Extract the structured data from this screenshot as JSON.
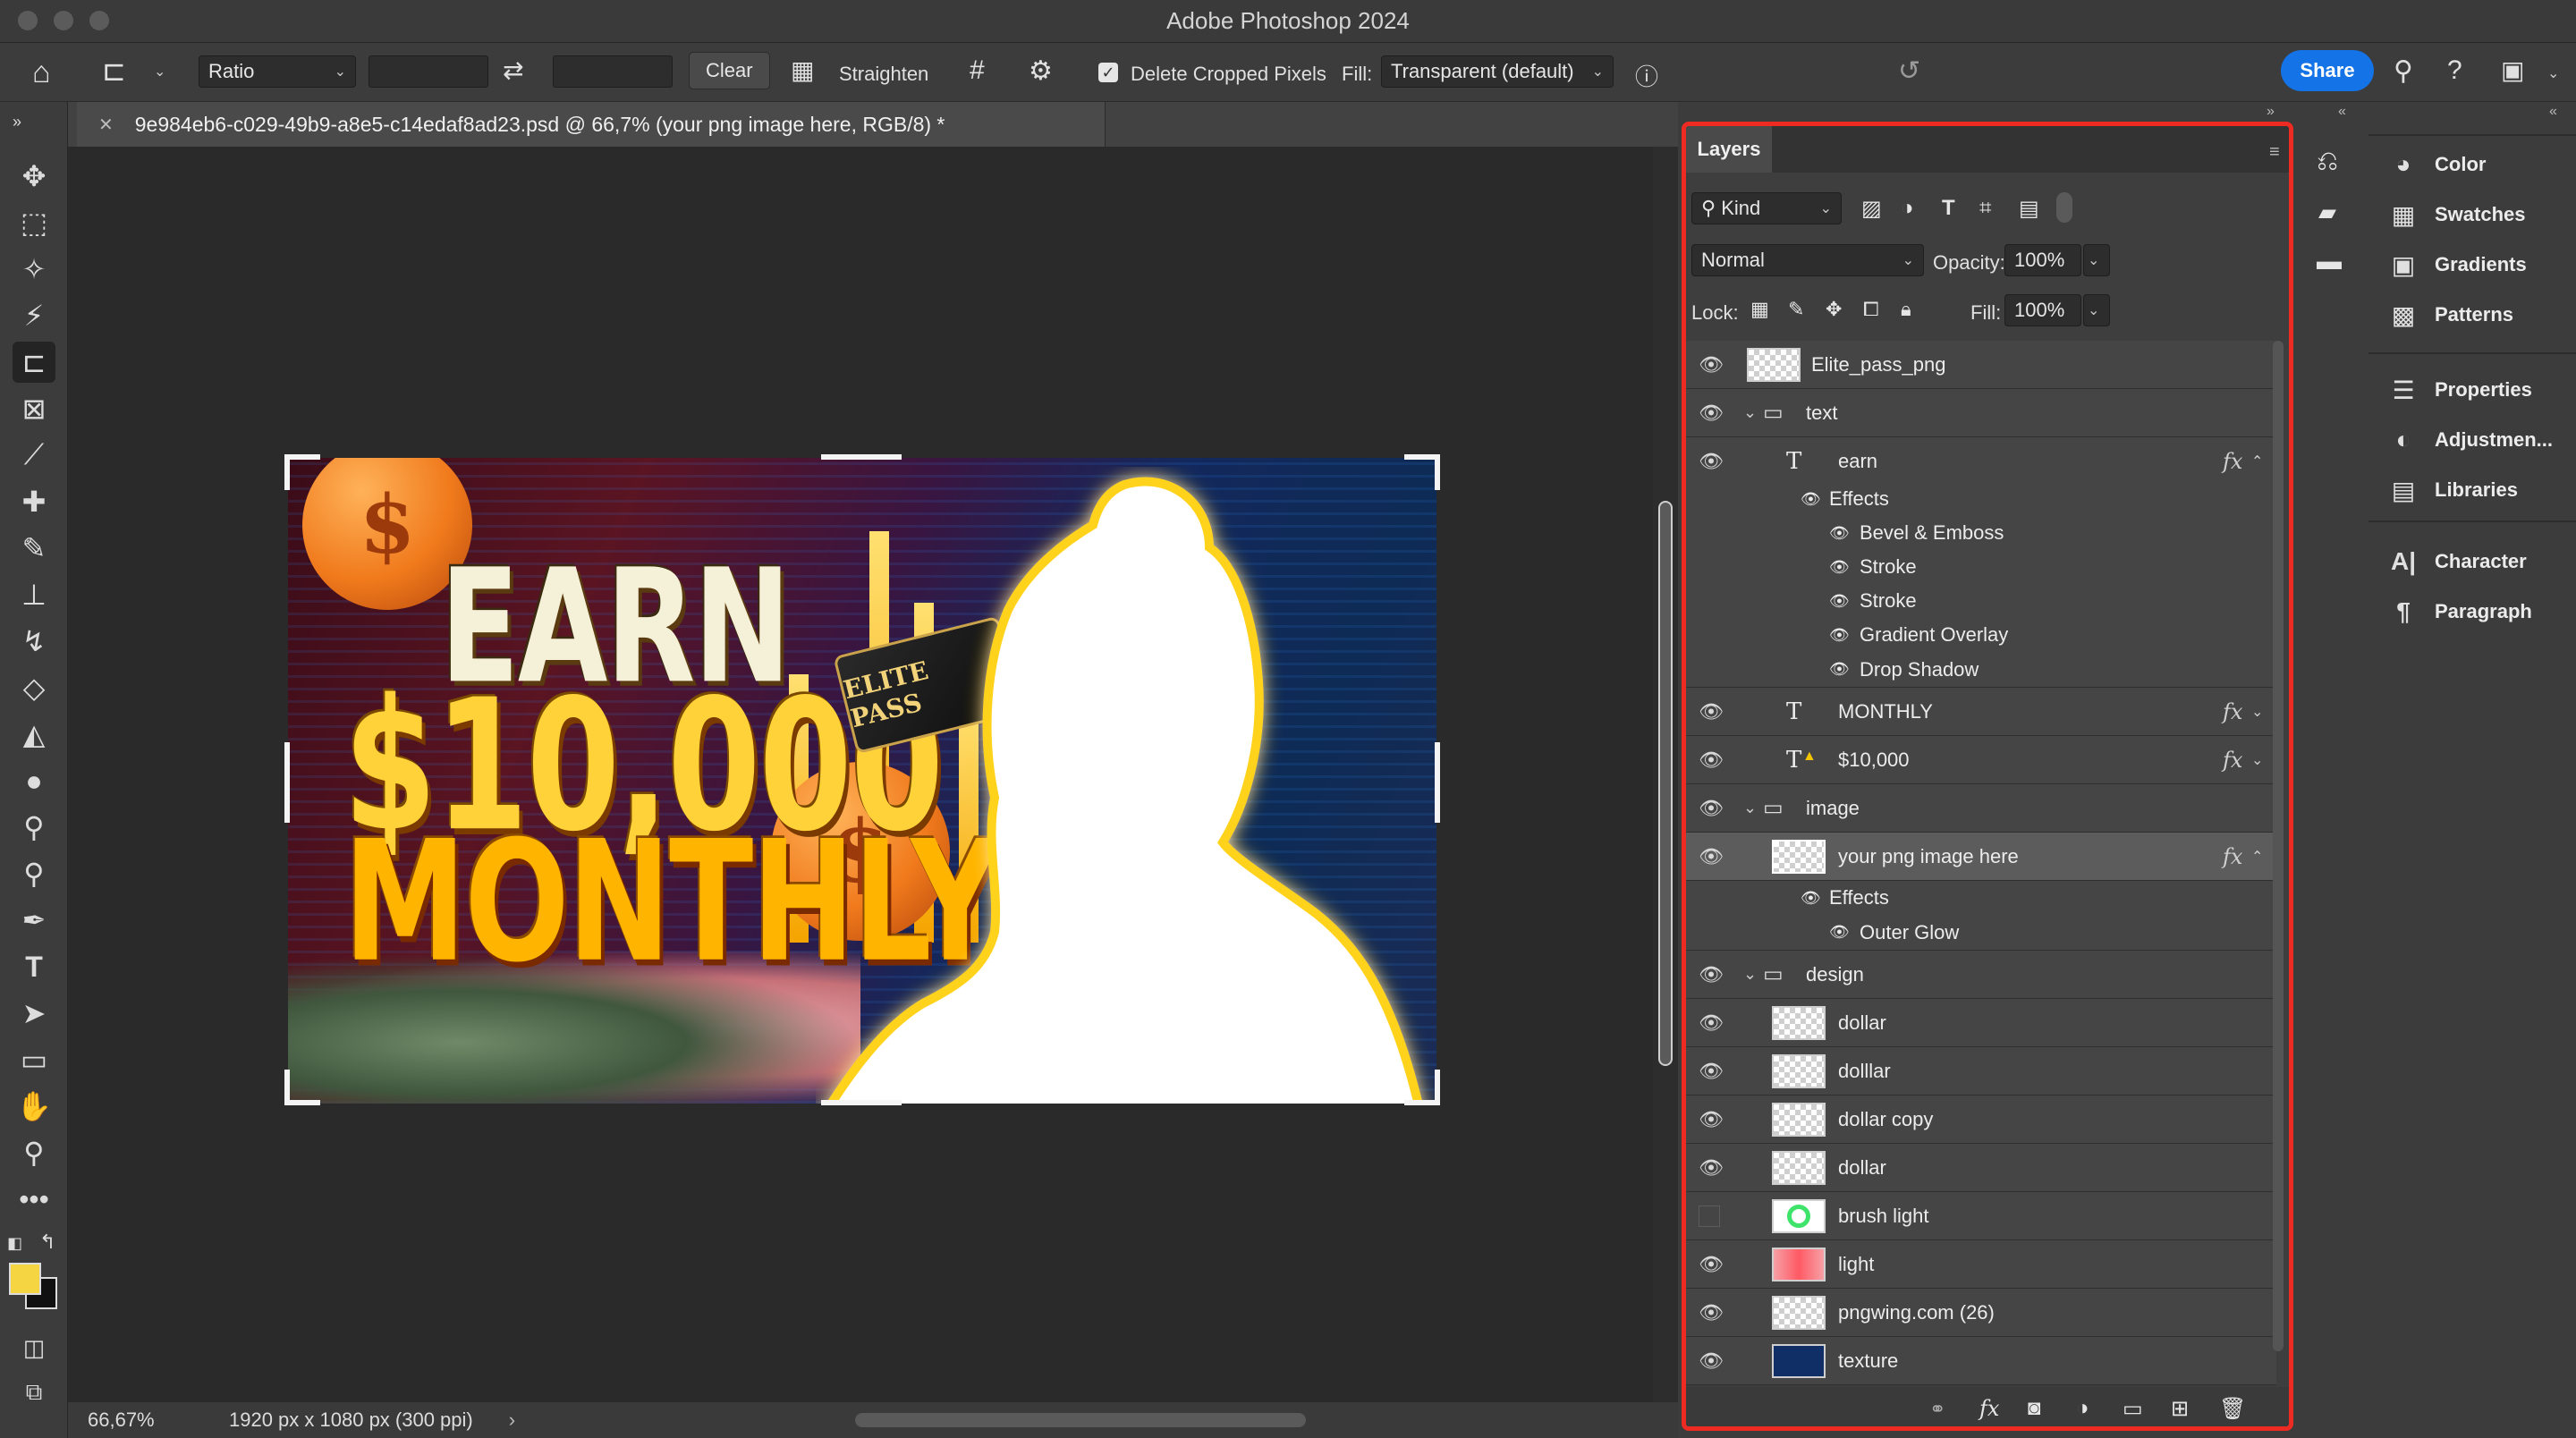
{
  "app": {
    "title": "Adobe Photoshop 2024"
  },
  "options_bar": {
    "ratio_label": "Ratio",
    "clear_label": "Clear",
    "straighten_label": "Straighten",
    "delete_cropped_label": "Delete Cropped Pixels",
    "fill_label": "Fill:",
    "fill_value": "Transparent (default)",
    "share_label": "Share"
  },
  "document": {
    "tab_title": "9e984eb6-c029-49b9-a8e5-c14edaf8ad23.psd @ 66,7% (your png image here, RGB/8) *",
    "zoom": "66,67%",
    "dimensions": "1920 px x 1080 px (300 ppi)"
  },
  "artwork": {
    "line1": "EARN",
    "line2": "$10,000",
    "line3": "MONTHLY",
    "card_text": "ELITE PASS",
    "coin_symbol": "$"
  },
  "layers_panel": {
    "title": "Layers",
    "kind_label": "Kind",
    "blend_mode": "Normal",
    "opacity_label": "Opacity:",
    "opacity_value": "100%",
    "lock_label": "Lock:",
    "fill_label": "Fill:",
    "fill_value": "100%",
    "rows": [
      {
        "name": "Elite_pass_png"
      },
      {
        "name": "text"
      },
      {
        "name": "earn"
      },
      {
        "name": "Effects"
      },
      {
        "name": "Bevel & Emboss"
      },
      {
        "name": "Stroke"
      },
      {
        "name": "Stroke"
      },
      {
        "name": "Gradient Overlay"
      },
      {
        "name": "Drop Shadow"
      },
      {
        "name": "MONTHLY"
      },
      {
        "name": "$10,000"
      },
      {
        "name": "image"
      },
      {
        "name": "your png image here"
      },
      {
        "name": "Effects"
      },
      {
        "name": "Outer Glow"
      },
      {
        "name": "design"
      },
      {
        "name": "dollar"
      },
      {
        "name": "dolllar"
      },
      {
        "name": "dollar copy"
      },
      {
        "name": "dollar"
      },
      {
        "name": "brush light"
      },
      {
        "name": "light"
      },
      {
        "name": "pngwing.com (26)"
      },
      {
        "name": "texture"
      }
    ]
  },
  "right_panels": {
    "group1": [
      "Color",
      "Swatches",
      "Gradients",
      "Patterns"
    ],
    "group2": [
      "Properties",
      "Adjustmen...",
      "Libraries"
    ],
    "group3": [
      "Character",
      "Paragraph"
    ]
  },
  "colors": {
    "accent": "#1473e6",
    "highlight_border": "#ee2b22",
    "foreground_swatch": "#f5d542"
  }
}
